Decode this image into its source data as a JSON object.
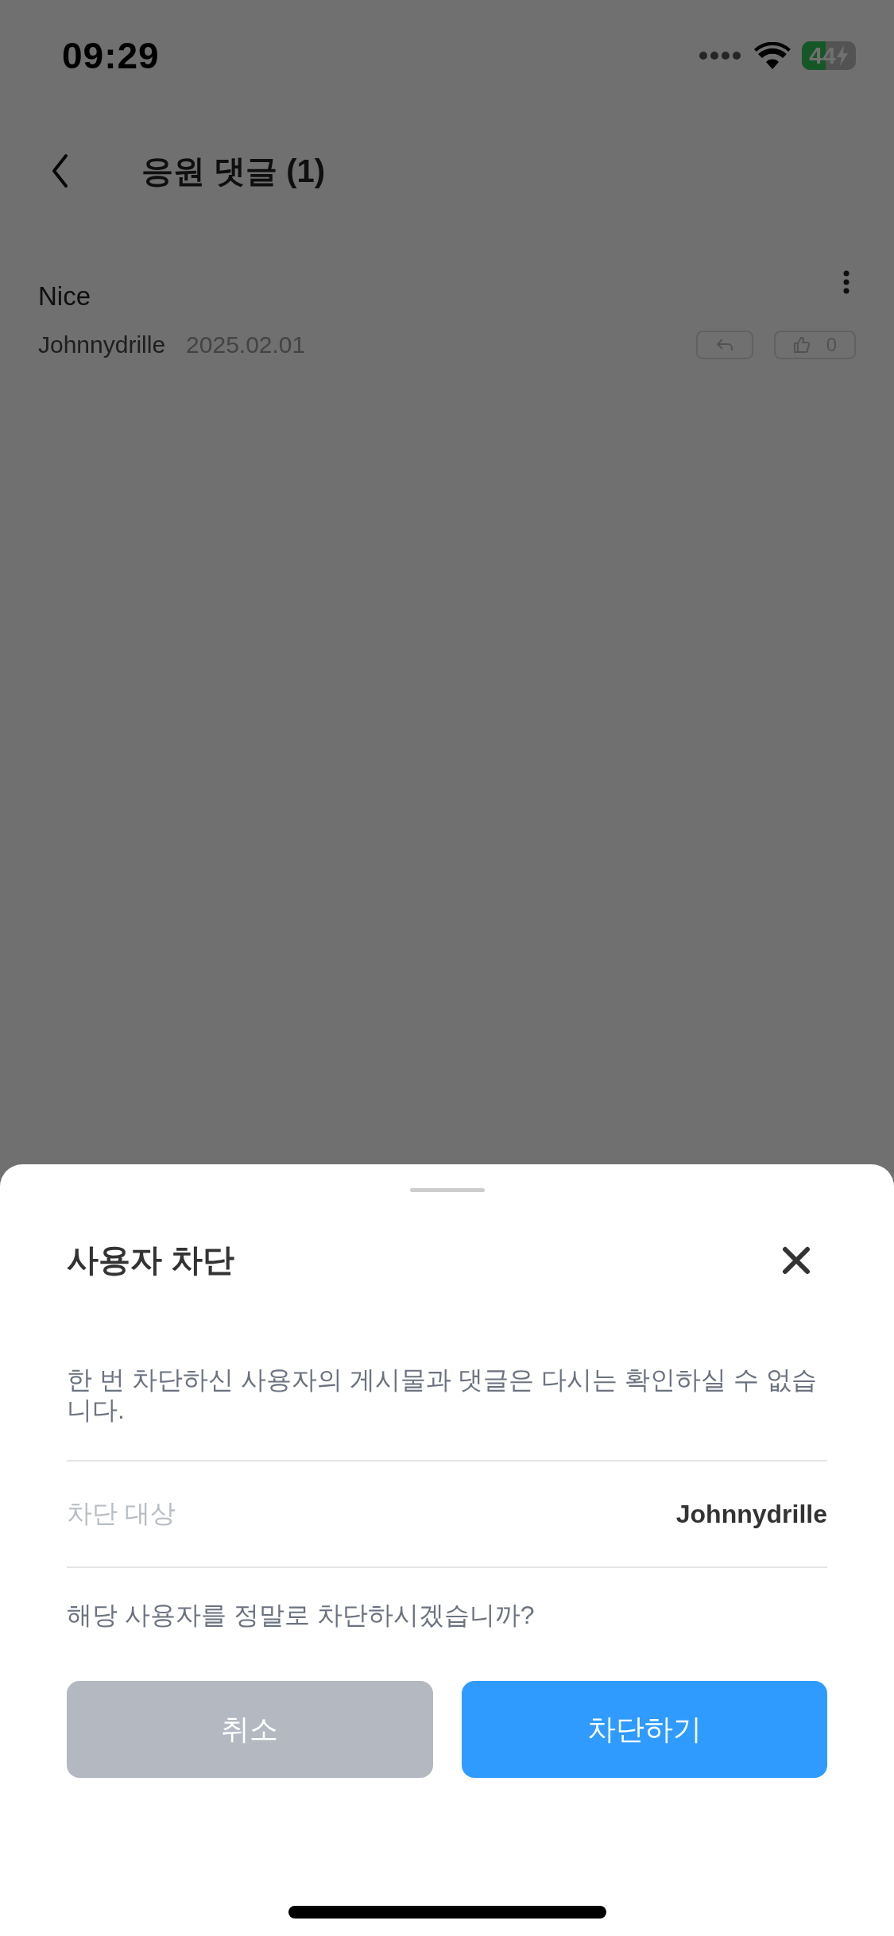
{
  "status_bar": {
    "time": "09:29",
    "battery": "44"
  },
  "header": {
    "title": "응원 댓글 (1)"
  },
  "comments": [
    {
      "text": "Nice",
      "author": "Johnnydrille",
      "date": "2025.02.01",
      "likes": "0"
    }
  ],
  "sheet": {
    "title": "사용자 차단",
    "description": "한 번 차단하신 사용자의 게시물과 댓글은 다시는 확인하실 수 없습니다.",
    "target_label": "차단 대상",
    "target_value": "Johnnydrille",
    "question": "해당 사용자를 정말로 차단하시겠습니까?",
    "buttons": [
      {
        "label": "취소",
        "kind": "cancel"
      },
      {
        "label": "차단하기",
        "kind": "confirm"
      }
    ]
  }
}
